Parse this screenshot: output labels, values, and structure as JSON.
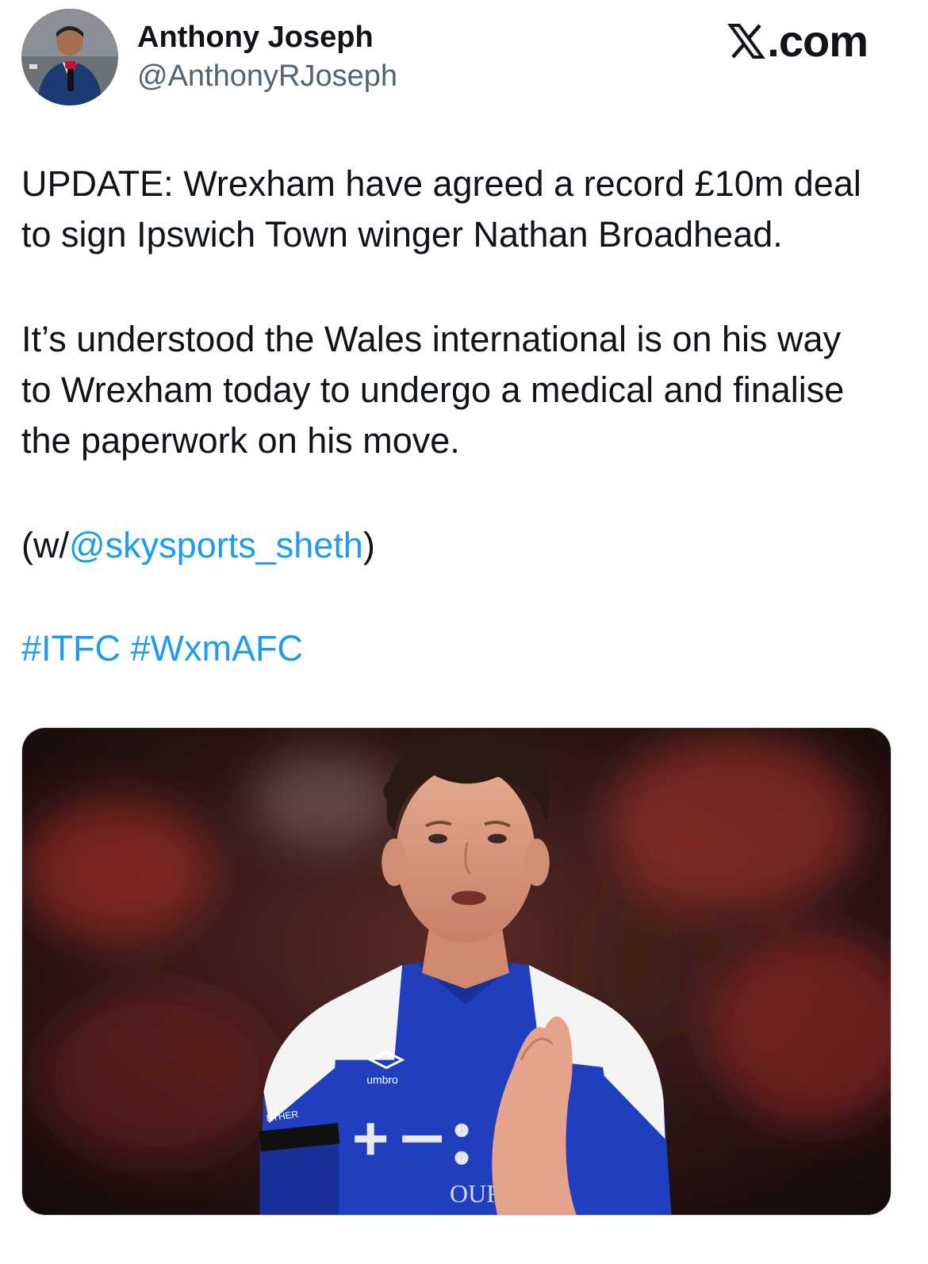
{
  "author": {
    "display_name": "Anthony Joseph",
    "handle": "@AnthonyRJoseph",
    "avatar_icon": "profile-avatar"
  },
  "brand": {
    "logo_icon": "x-logo-icon",
    "label": ".com"
  },
  "tweet": {
    "paragraph1": [
      "UPDATE: Wrexham have agreed a record £10m deal",
      "to sign Ipswich Town winger Nathan Broadhead."
    ],
    "paragraph2": [
      "It’s understood the Wales international is on his way",
      "to Wrexham today to undergo a medical and finalise",
      "the paperwork on his move."
    ],
    "credit_prefix": "(w/",
    "credit_mention": "@skysports_sheth",
    "credit_suffix": ")",
    "hashtag1": "#ITFC",
    "hashtag2": "#WxmAFC"
  },
  "media": {
    "kit_sponsor_text": "umbro",
    "shirt_text": "OUR",
    "armband_text": "ETHER"
  },
  "colors": {
    "text": "#0f1419",
    "secondary": "#536471",
    "link": "#1d9bf0"
  }
}
